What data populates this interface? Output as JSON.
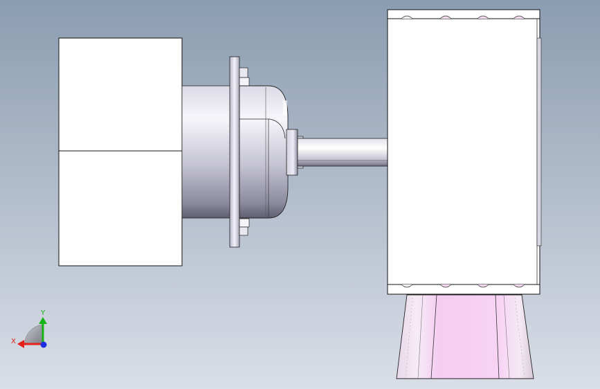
{
  "viewport": {
    "background_top": "#8b9db1",
    "background_bottom": "#dadee7"
  },
  "model": {
    "white_face": "#ffffff",
    "outline": "#111111",
    "metal_light": "#f4f4fa",
    "metal_mid": "#c9c8d6",
    "metal_dark": "#6f6e80",
    "pink_face": "#f5cdf2"
  },
  "triad": {
    "x_label": "X",
    "y_label": "Y",
    "x_color": "#e8201c",
    "y_color": "#16b416",
    "z_color": "#1f2fe0"
  }
}
